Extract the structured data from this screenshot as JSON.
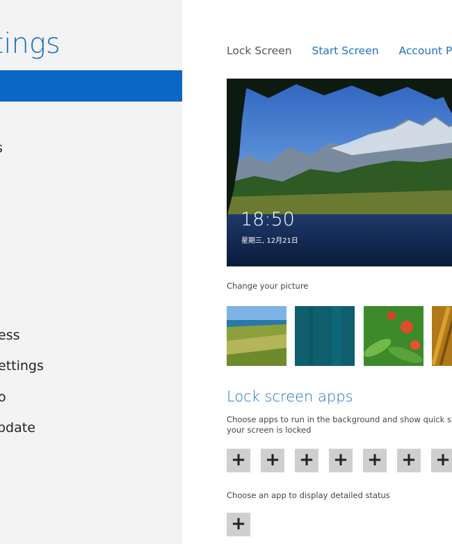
{
  "sidebar": {
    "title": "ttings",
    "items": [
      {
        "label": "s"
      },
      {
        "label": "ess"
      },
      {
        "label": "ettings"
      },
      {
        "label": "o"
      },
      {
        "label": "pdate"
      }
    ]
  },
  "tabs": [
    {
      "label": "Lock Screen"
    },
    {
      "label": "Start Screen"
    },
    {
      "label": "Account Pictur"
    }
  ],
  "preview": {
    "time": "18:50",
    "date": "星期三, 12月21日"
  },
  "change_picture_label": "Change your picture",
  "lock_apps": {
    "heading": "Lock screen apps",
    "description": "Choose apps to run in the background and show quick status your screen is locked",
    "add_symbol": "+",
    "detailed_label": "Choose an app to display detailed status"
  },
  "colors": {
    "accent": "#1c72c4",
    "selection": "#0a67c6"
  }
}
